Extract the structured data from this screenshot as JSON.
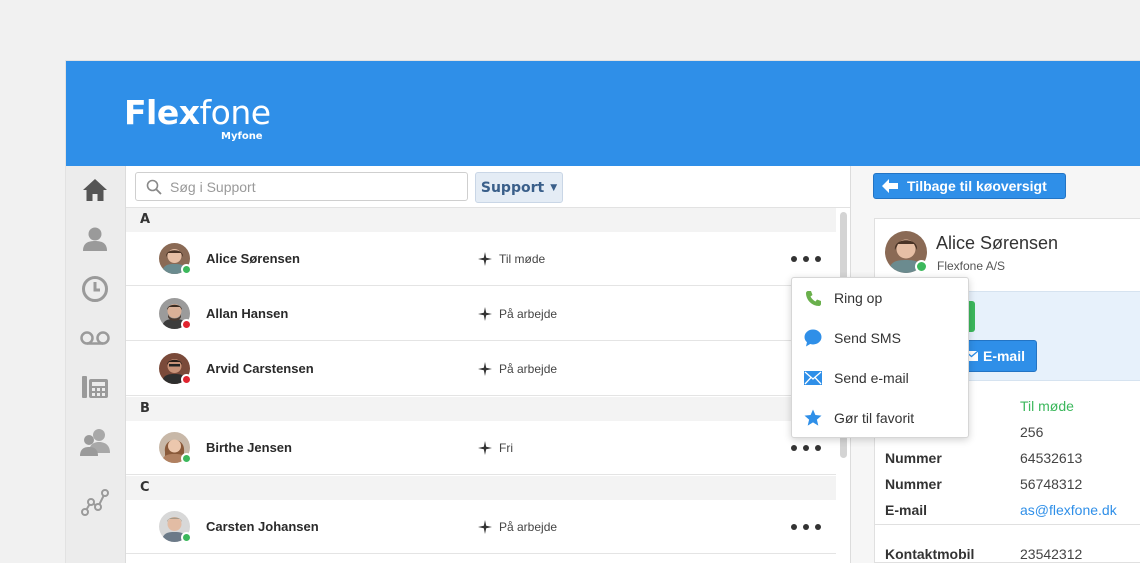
{
  "brand": {
    "name_bold": "Flex",
    "name_light": "fone",
    "product": "Myfone"
  },
  "nav": {
    "items": [
      "home-icon",
      "user-icon",
      "clock-icon",
      "voicemail-icon",
      "phone-system-icon",
      "group-icon",
      "stats-icon"
    ]
  },
  "search": {
    "placeholder": "Søg i Support",
    "value": ""
  },
  "department": {
    "selected": "Support"
  },
  "groups": [
    {
      "letter": "A",
      "contacts": [
        {
          "name": "Alice Sørensen",
          "status": "Til møde",
          "presence": "available",
          "presence_color": "#3cb85c"
        },
        {
          "name": "Allan Hansen",
          "status": "På arbejde",
          "presence": "busy",
          "presence_color": "#e0242f"
        },
        {
          "name": "Arvid Carstensen",
          "status": "På arbejde",
          "presence": "busy",
          "presence_color": "#e0242f"
        }
      ]
    },
    {
      "letter": "B",
      "contacts": [
        {
          "name": "Birthe Jensen",
          "status": "Fri",
          "presence": "available",
          "presence_color": "#3cb85c"
        }
      ]
    },
    {
      "letter": "C",
      "contacts": [
        {
          "name": "Carsten Johansen",
          "status": "På arbejde",
          "presence": "available",
          "presence_color": "#3cb85c"
        }
      ]
    }
  ],
  "context_menu": {
    "items": [
      {
        "label": "Ring op",
        "icon": "phone-icon",
        "color": "#6ab04c"
      },
      {
        "label": "Send SMS",
        "icon": "sms-icon",
        "color": "#2f8fe8"
      },
      {
        "label": "Send e-mail",
        "icon": "mail-icon",
        "color": "#2f8fe8"
      },
      {
        "label": "Gør til favorit",
        "icon": "star-icon",
        "color": "#2f8fe8"
      }
    ]
  },
  "detail": {
    "back_label": "Tilbage til køoversigt",
    "name": "Alice Sørensen",
    "company": "Flexfone A/S",
    "email_button": "E-mail",
    "fields": [
      {
        "key": "",
        "value": "Til møde",
        "color": "#3cb85c"
      },
      {
        "key": "",
        "value": "256",
        "color": "#444444"
      },
      {
        "key": "Nummer",
        "value": "64532613",
        "color": "#444444"
      },
      {
        "key": "Nummer",
        "value": "56748312",
        "color": "#444444"
      },
      {
        "key": "E-mail",
        "value": "as@flexfone.dk",
        "color": "#2f8fe8"
      },
      {
        "key": "Kontaktmobil",
        "value": "23542312",
        "color": "#444444"
      }
    ]
  },
  "colors": {
    "accent": "#2f8fe8",
    "available": "#3cb85c",
    "busy": "#e0242f"
  }
}
